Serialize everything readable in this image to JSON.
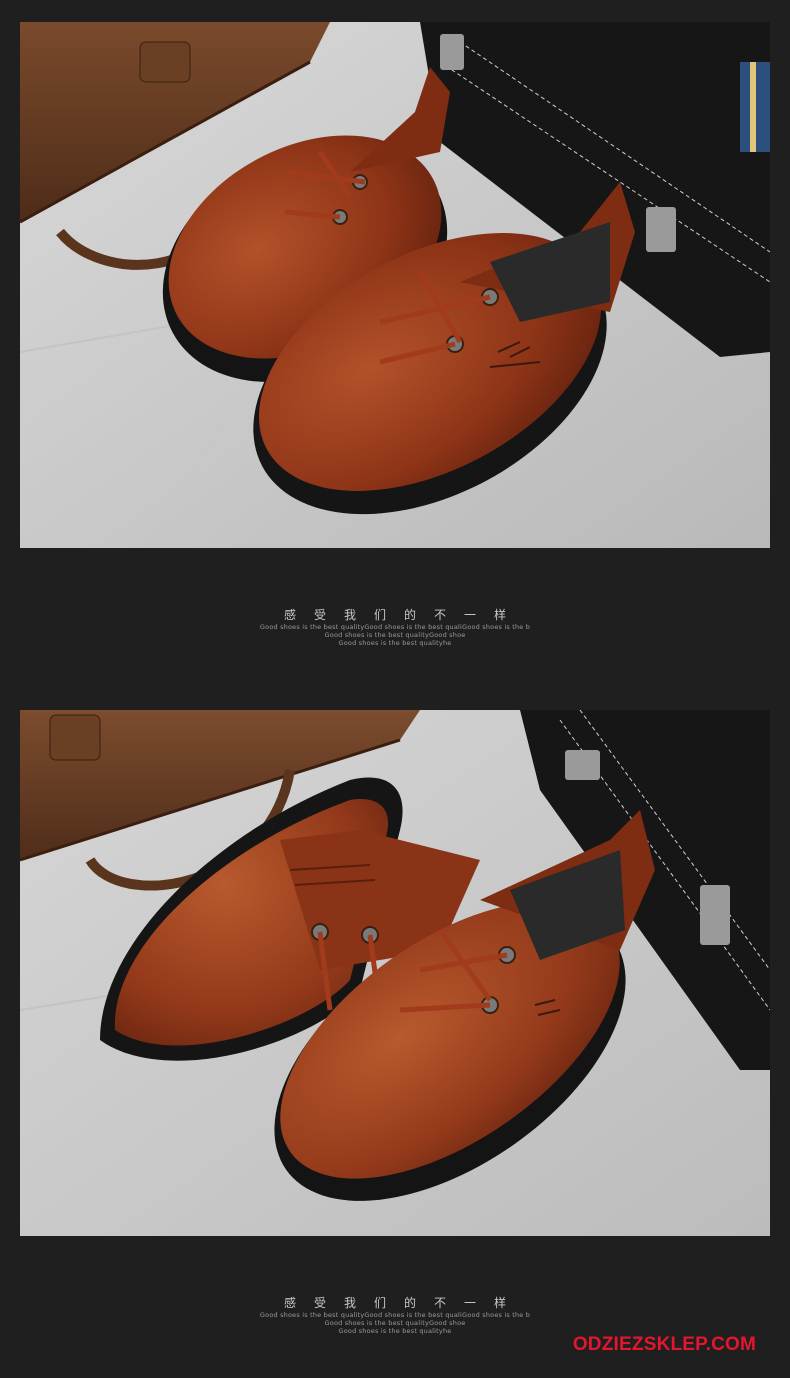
{
  "captions": [
    {
      "title_chars": [
        "感",
        "受",
        "我",
        "们",
        "的",
        "不",
        "一",
        "样"
      ],
      "lines": [
        "Good shoes is the best qualityGood shoes is the best qualiGood shoes is the b",
        "Good shoes is the best qualityGood shoe",
        "Good shoes is the best qualityhe"
      ]
    },
    {
      "title_chars": [
        "感",
        "受",
        "我",
        "们",
        "的",
        "不",
        "一",
        "样"
      ],
      "lines": [
        "Good shoes is the best qualityGood shoes is the best qualiGood shoes is the b",
        "Good shoes is the best qualityGood shoe",
        "Good shoes is the best qualityhe"
      ]
    }
  ],
  "watermark": "ODZIEZSKLEP.COM",
  "colors": {
    "background": "#1f1f1f",
    "leather": "#8f3318",
    "watermark": "#e4162e"
  }
}
